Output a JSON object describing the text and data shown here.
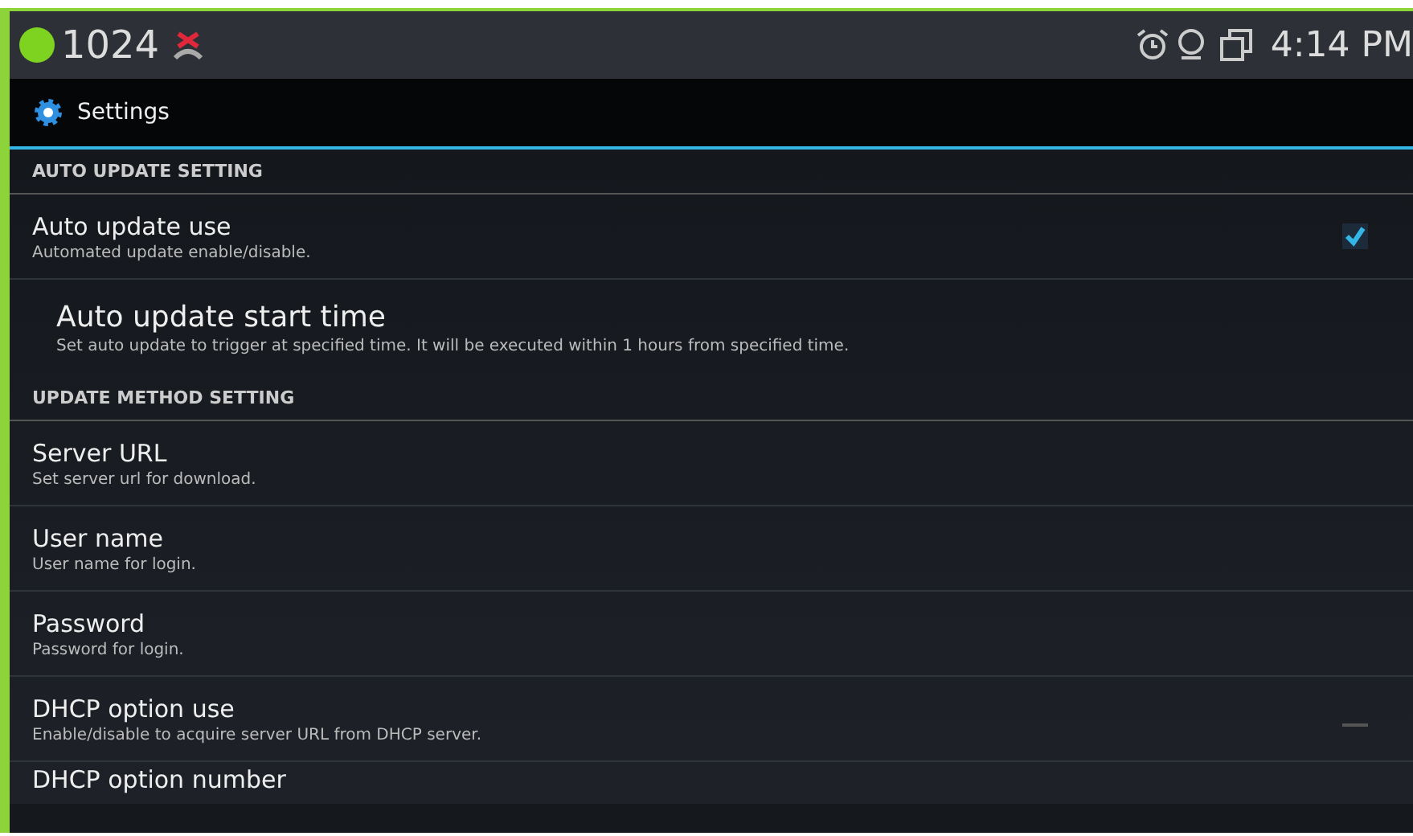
{
  "status_bar": {
    "extension": "1024",
    "time": "4:14 PM"
  },
  "action_bar": {
    "title": "Settings"
  },
  "sections": [
    {
      "header": "AUTO UPDATE SETTING",
      "items": [
        {
          "kind": "checkbox",
          "title": "Auto update use",
          "summary": "Automated update enable/disable.",
          "checked": true
        },
        {
          "kind": "plain",
          "title": "Auto update start time",
          "summary": "Set auto update to trigger at specified time. It will be executed within 1 hours from specified time."
        }
      ]
    },
    {
      "header": "UPDATE METHOD SETTING",
      "items": [
        {
          "kind": "plain",
          "title": "Server URL",
          "summary": "Set server url for download."
        },
        {
          "kind": "plain",
          "title": "User name",
          "summary": "User name for login."
        },
        {
          "kind": "plain",
          "title": "Password",
          "summary": "Password for login."
        },
        {
          "kind": "checkbox",
          "title": "DHCP option use",
          "summary": "Enable/disable to acquire server URL from DHCP server.",
          "checked": false
        },
        {
          "kind": "partial",
          "title": "DHCP option number"
        }
      ]
    }
  ]
}
